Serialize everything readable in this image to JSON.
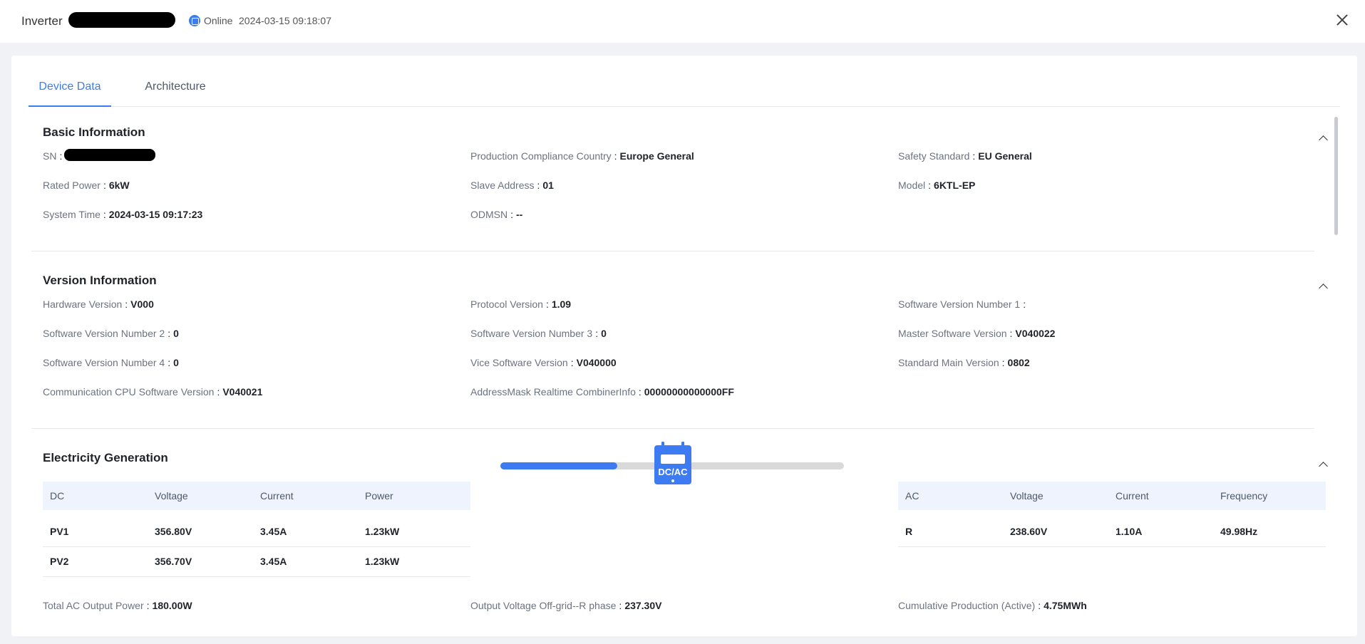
{
  "header": {
    "title": "Inverter",
    "status": "Online",
    "timestamp": "2024-03-15 09:18:07"
  },
  "tabs": [
    {
      "label": "Device Data",
      "active": true
    },
    {
      "label": "Architecture",
      "active": false
    }
  ],
  "basic": {
    "title": "Basic Information",
    "fields": [
      {
        "label": "SN",
        "value": ""
      },
      {
        "label": "Production Compliance Country",
        "value": "Europe General"
      },
      {
        "label": "Safety Standard",
        "value": "EU General"
      },
      {
        "label": "Rated Power",
        "value": "6kW"
      },
      {
        "label": "Slave Address",
        "value": "01"
      },
      {
        "label": "Model",
        "value": "6KTL-EP"
      },
      {
        "label": "System Time",
        "value": "2024-03-15 09:17:23"
      },
      {
        "label": "ODMSN",
        "value": "--"
      }
    ]
  },
  "version": {
    "title": "Version Information",
    "fields": [
      {
        "label": "Hardware Version",
        "value": "V000"
      },
      {
        "label": "Protocol Version",
        "value": "1.09"
      },
      {
        "label": "Software Version Number 1",
        "value": ""
      },
      {
        "label": "Software Version Number 2",
        "value": "0"
      },
      {
        "label": "Software Version Number 3",
        "value": "0"
      },
      {
        "label": "Master Software Version",
        "value": "V040022"
      },
      {
        "label": "Software Version Number 4",
        "value": "0"
      },
      {
        "label": "Vice Software Version",
        "value": "V040000"
      },
      {
        "label": "Standard Main Version",
        "value": "0802"
      },
      {
        "label": "Communication CPU Software Version",
        "value": "V040021"
      },
      {
        "label": "AddressMask Realtime CombinerInfo",
        "value": "00000000000000FF"
      }
    ]
  },
  "generation": {
    "title": "Electricity Generation",
    "dc_table": {
      "headers": [
        "DC",
        "Voltage",
        "Current",
        "Power"
      ],
      "rows": [
        [
          "PV1",
          "356.80V",
          "3.45A",
          "1.23kW"
        ],
        [
          "PV2",
          "356.70V",
          "3.45A",
          "1.23kW"
        ]
      ]
    },
    "ac_table": {
      "headers": [
        "AC",
        "Voltage",
        "Current",
        "Frequency"
      ],
      "rows": [
        [
          "R",
          "238.60V",
          "1.10A",
          "49.98Hz"
        ]
      ]
    },
    "converter_label": "DC/AC",
    "flow_progress": 0.34,
    "fields": [
      {
        "label": "Total AC Output Power",
        "value": "180.00W"
      },
      {
        "label": "Output Voltage Off-grid--R phase",
        "value": "237.30V"
      },
      {
        "label": "Cumulative Production (Active)",
        "value": "4.75MWh"
      }
    ]
  },
  "colors": {
    "accent": "#3d7bf2",
    "table_header_bg": "#eef3fd",
    "track": "#d9d9d9"
  }
}
